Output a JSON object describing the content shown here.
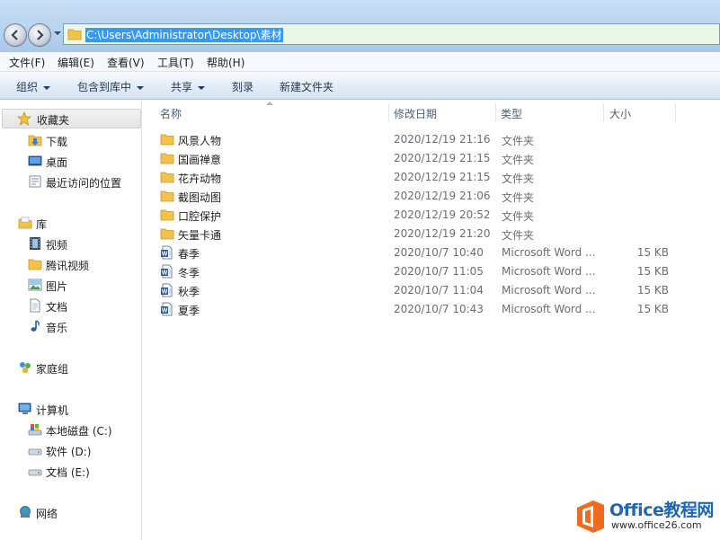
{
  "address_bar": {
    "path": "C:\\Users\\Administrator\\Desktop\\素材"
  },
  "menu": [
    "文件(F)",
    "编辑(E)",
    "查看(V)",
    "工具(T)",
    "帮助(H)"
  ],
  "toolbar": {
    "organize": "组织",
    "include_in_library": "包含到库中",
    "share": "共享",
    "burn": "刻录",
    "new_folder": "新建文件夹"
  },
  "sidebar": {
    "favorites": {
      "label": "收藏夹",
      "items": [
        "下载",
        "桌面",
        "最近访问的位置"
      ]
    },
    "libraries": {
      "label": "库",
      "items": [
        "视频",
        "腾讯视频",
        "图片",
        "文档",
        "音乐"
      ]
    },
    "homegroup": {
      "label": "家庭组"
    },
    "computer": {
      "label": "计算机",
      "items": [
        "本地磁盘 (C:)",
        "软件 (D:)",
        "文档 (E:)"
      ]
    },
    "network": {
      "label": "网络"
    }
  },
  "columns": {
    "name": "名称",
    "modified": "修改日期",
    "type": "类型",
    "size": "大小"
  },
  "files": [
    {
      "name": "风景人物",
      "date": "2020/12/19 21:16",
      "type": "文件夹",
      "size": "",
      "icon": "folder-icon"
    },
    {
      "name": "国画禅意",
      "date": "2020/12/19 21:15",
      "type": "文件夹",
      "size": "",
      "icon": "folder-icon"
    },
    {
      "name": "花卉动物",
      "date": "2020/12/19 21:15",
      "type": "文件夹",
      "size": "",
      "icon": "folder-icon"
    },
    {
      "name": "截图动图",
      "date": "2020/12/19 21:06",
      "type": "文件夹",
      "size": "",
      "icon": "folder-icon"
    },
    {
      "name": "口腔保护",
      "date": "2020/12/19 20:52",
      "type": "文件夹",
      "size": "",
      "icon": "folder-icon"
    },
    {
      "name": "矢量卡通",
      "date": "2020/12/19 21:20",
      "type": "文件夹",
      "size": "",
      "icon": "folder-icon"
    },
    {
      "name": "春季",
      "date": "2020/10/7 10:40",
      "type": "Microsoft Word ...",
      "size": "15 KB",
      "icon": "word-document-icon"
    },
    {
      "name": "冬季",
      "date": "2020/10/7 11:05",
      "type": "Microsoft Word ...",
      "size": "15 KB",
      "icon": "word-document-icon"
    },
    {
      "name": "秋季",
      "date": "2020/10/7 11:04",
      "type": "Microsoft Word ...",
      "size": "15 KB",
      "icon": "word-document-icon"
    },
    {
      "name": "夏季",
      "date": "2020/10/7 10:43",
      "type": "Microsoft Word ...",
      "size": "15 KB",
      "icon": "word-document-icon"
    }
  ],
  "watermark": {
    "title": "Office教程网",
    "url": "www.office26.com"
  },
  "colors": {
    "folder": "#f2c24b",
    "selection": "#3399ff",
    "address_bg": "#eaf6e6",
    "watermark_orange": "#f26b1d",
    "watermark_blue": "#1f66b8"
  }
}
